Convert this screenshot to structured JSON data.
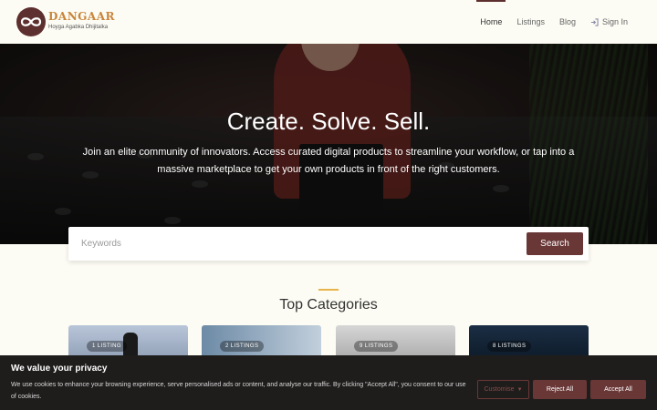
{
  "brand": {
    "name": "DANGAAR",
    "tagline": "Hoyga Agabka Dhijitalka",
    "logo_icon": "infinity-icon"
  },
  "nav": {
    "items": [
      {
        "label": "Home",
        "active": true
      },
      {
        "label": "Listings",
        "active": false
      },
      {
        "label": "Blog",
        "active": false
      }
    ],
    "signin_label": "Sign In",
    "signin_icon": "sign-in-icon"
  },
  "hero": {
    "title": "Create. Solve. Sell.",
    "subtitle": "Join an elite community of innovators. Access curated digital products to streamline your workflow, or tap into a massive marketplace to get your own products in front of the right customers."
  },
  "search": {
    "placeholder": "Keywords",
    "value": "",
    "button_label": "Search"
  },
  "categories": {
    "title": "Top Categories",
    "cards": [
      {
        "badge": "1 LISTING"
      },
      {
        "badge": "2 LISTINGS"
      },
      {
        "badge": "9 LISTINGS"
      },
      {
        "badge": "8 LISTINGS"
      }
    ]
  },
  "cookie": {
    "title": "We value your privacy",
    "text": "We use cookies to enhance your browsing experience, serve personalised ads or content, and analyse our traffic. By clicking \"Accept All\", you consent to our use of cookies.",
    "customise_label": "Customise",
    "reject_label": "Reject All",
    "accept_label": "Accept All"
  },
  "colors": {
    "accent": "#6a3737",
    "brand_gold": "#c9853a",
    "divider_gold": "#e7b44c",
    "page_bg": "#fdfcf4"
  }
}
